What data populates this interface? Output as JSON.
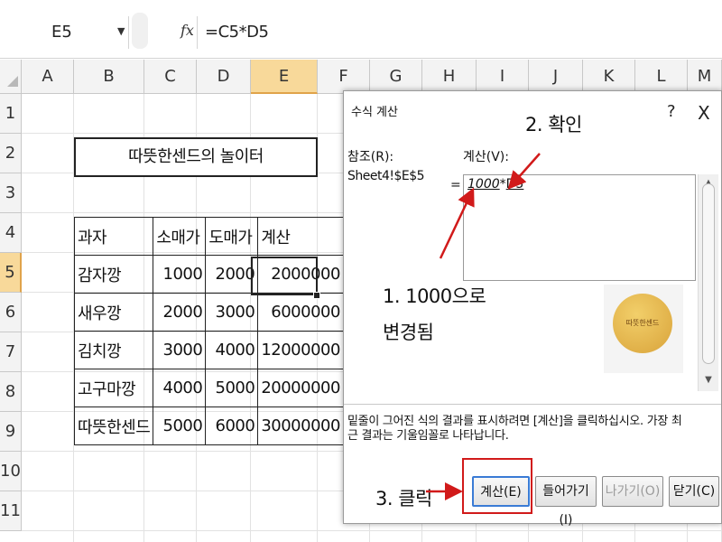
{
  "formula_bar": {
    "name_box": "E5",
    "fx": "fx",
    "formula": "=C5*D5"
  },
  "columns": [
    "A",
    "B",
    "C",
    "D",
    "E",
    "F",
    "G",
    "H",
    "I",
    "J",
    "K",
    "L",
    "M"
  ],
  "rows": [
    "1",
    "2",
    "3",
    "4",
    "5",
    "6",
    "7",
    "8",
    "9",
    "10",
    "11"
  ],
  "sheet": {
    "title": "따뜻한센드의 놀이터",
    "table_headers": [
      "과자",
      "소매가",
      "도매가",
      "계산"
    ],
    "table_rows": [
      [
        "감자깡",
        "1000",
        "2000",
        "2000000"
      ],
      [
        "새우깡",
        "2000",
        "3000",
        "6000000"
      ],
      [
        "김치깡",
        "3000",
        "4000",
        "12000000"
      ],
      [
        "고구마깡",
        "4000",
        "5000",
        "20000000"
      ],
      [
        "따뜻한센드",
        "5000",
        "6000",
        "30000000"
      ]
    ],
    "selected_column": "E",
    "selected_row": "5"
  },
  "dialog": {
    "title": "수식 계산",
    "help": "?",
    "close": "X",
    "reference_label": "참조(R):",
    "reference_value": "Sheet4!$E$5",
    "equals": "=",
    "evaluation_label": "계산(V):",
    "evaluation_first": "1000",
    "evaluation_op": "*",
    "evaluation_second": "D5",
    "hint": "밑줄이 그어진 식의 결과를 표시하려면 [계산]을 클릭하십시오. 가장 최근 결과는 기울임꼴로 나타납니다.",
    "buttons": {
      "evaluate": "계산(E)",
      "step_in": "들어가기(I)",
      "step_out": "나가기(O)",
      "close": "닫기(C)"
    },
    "sticker_text": "따뜻한센드"
  },
  "annotations": {
    "step1_line1": "1. 1000으로",
    "step1_line2": "변경됨",
    "step2": "2. 확인",
    "step3": "3. 클릭"
  },
  "colors": {
    "annotation_arrow": "#d11a1a",
    "selected_header": "#f8d99a"
  }
}
